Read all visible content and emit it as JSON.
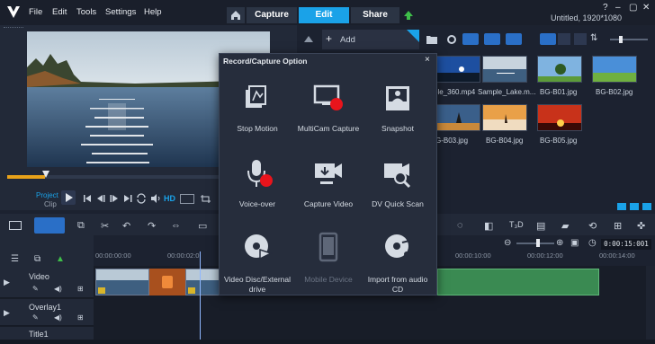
{
  "app": {
    "menu": [
      "File",
      "Edit",
      "Tools",
      "Settings",
      "Help"
    ],
    "modes": [
      "Capture",
      "Edit",
      "Share"
    ],
    "active_mode": "Edit",
    "project_title": "Untitled, 1920*1080"
  },
  "preview": {
    "project_label": "Project",
    "clip_label": "Clip",
    "hd_label": "HD",
    "scrub_position": 0.13
  },
  "library": {
    "add_label": "Add",
    "thumbnails": [
      {
        "caption": "ple_360.mp4",
        "scene": "blue-sky"
      },
      {
        "caption": "Sample_Lake.m...",
        "scene": "lake"
      },
      {
        "caption": "BG-B01.jpg",
        "scene": "tree-sky"
      },
      {
        "caption": "BG-B02.jpg",
        "scene": "green-field"
      },
      {
        "caption": "G-B03.jpg",
        "scene": "sunset-tree"
      },
      {
        "caption": "BG-B04.jpg",
        "scene": "desert-tree"
      },
      {
        "caption": "BG-B05.jpg",
        "scene": "red-sunset"
      }
    ]
  },
  "dialog": {
    "title": "Record/Capture Option",
    "close": "×",
    "options": [
      {
        "label": "Stop Motion",
        "icon": "stop-motion-icon",
        "enabled": true
      },
      {
        "label": "MultiCam Capture",
        "icon": "multicam-capture-icon",
        "enabled": true
      },
      {
        "label": "Snapshot",
        "icon": "snapshot-icon",
        "enabled": true
      },
      {
        "label": "Voice-over",
        "icon": "microphone-icon",
        "enabled": true
      },
      {
        "label": "Capture Video",
        "icon": "capture-video-icon",
        "enabled": true
      },
      {
        "label": "DV Quick Scan",
        "icon": "dv-quick-scan-icon",
        "enabled": true
      },
      {
        "label": "Video Disc/External drive",
        "icon": "video-disc-icon",
        "enabled": true
      },
      {
        "label": "Mobile Device",
        "icon": "mobile-device-icon",
        "enabled": false
      },
      {
        "label": "Import from audio CD",
        "icon": "audio-cd-icon",
        "enabled": true
      }
    ]
  },
  "timeline": {
    "ticks": [
      "00:00:00:00",
      "00:00:02:0",
      "00:00:10:00",
      "00:00:12:00",
      "00:00:14:00"
    ],
    "timecode": "0:00:15:001",
    "tracks": [
      "Video",
      "Overlay1",
      "Title1"
    ]
  },
  "colors": {
    "accent": "#1aa2e8",
    "panel": "#222938",
    "background": "#1c2230",
    "record_red": "#e8141c",
    "clip_green": "#3a8a52"
  }
}
